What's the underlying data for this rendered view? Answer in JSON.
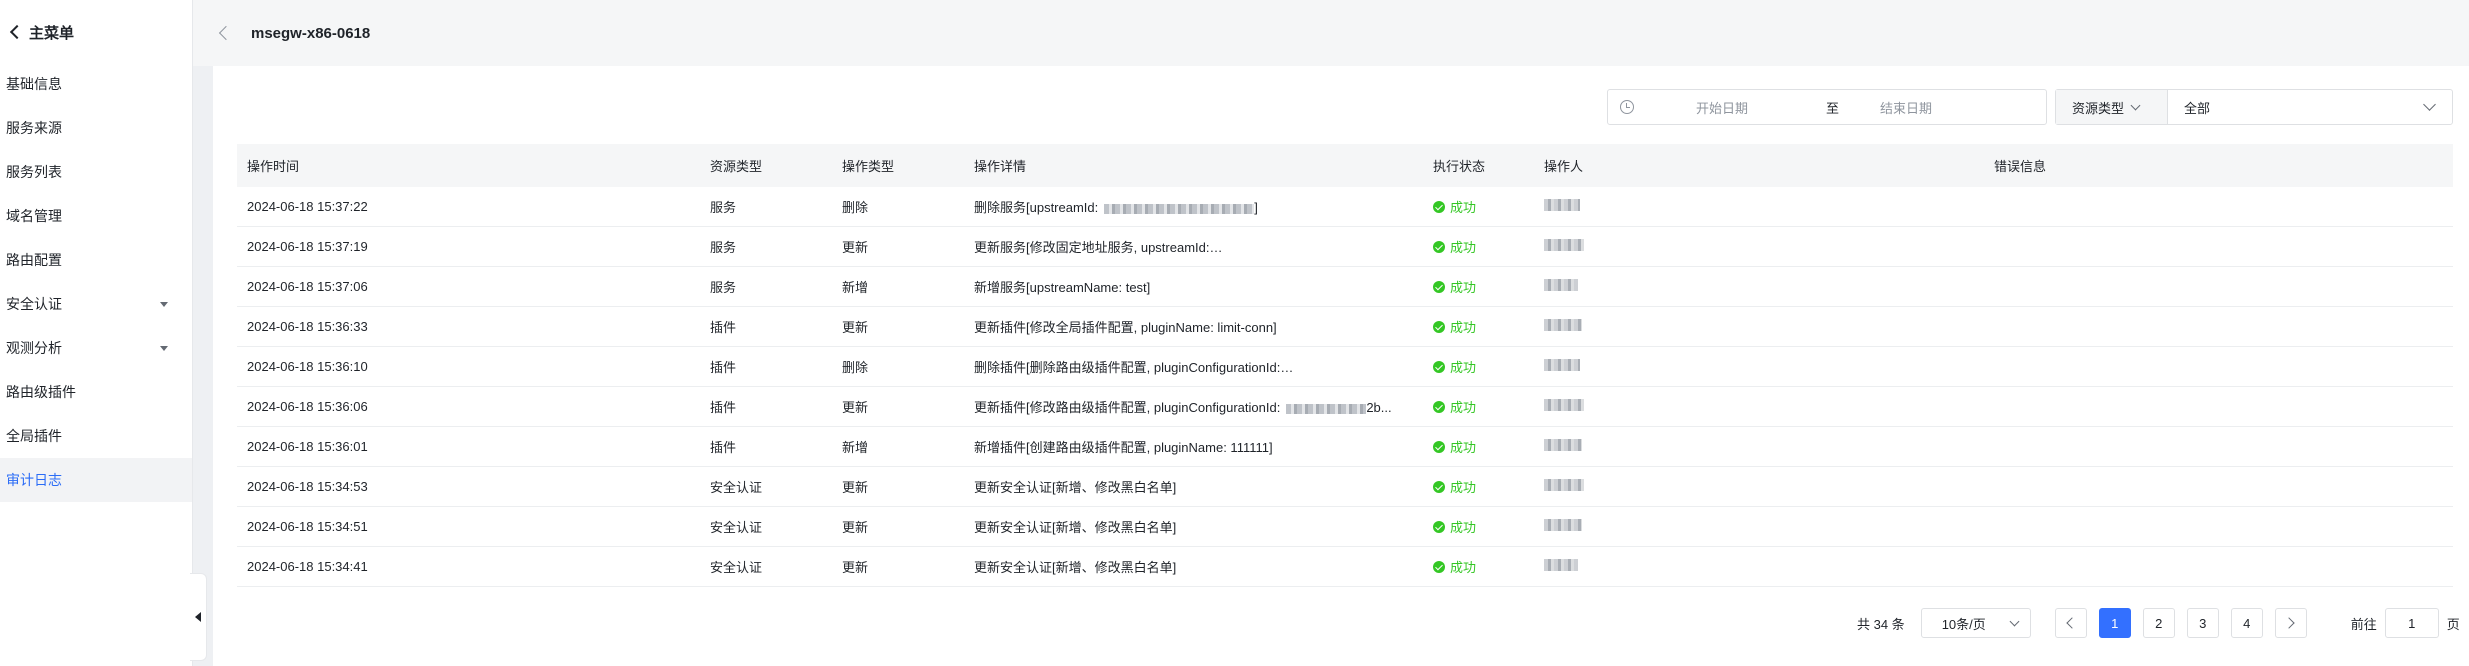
{
  "sidebar": {
    "back_label": "主菜单",
    "items": [
      {
        "label": "基础信息",
        "has_caret": false,
        "active": false
      },
      {
        "label": "服务来源",
        "has_caret": false,
        "active": false
      },
      {
        "label": "服务列表",
        "has_caret": false,
        "active": false
      },
      {
        "label": "域名管理",
        "has_caret": false,
        "active": false
      },
      {
        "label": "路由配置",
        "has_caret": false,
        "active": false
      },
      {
        "label": "安全认证",
        "has_caret": true,
        "active": false
      },
      {
        "label": "观测分析",
        "has_caret": true,
        "active": false
      },
      {
        "label": "路由级插件",
        "has_caret": false,
        "active": false
      },
      {
        "label": "全局插件",
        "has_caret": false,
        "active": false
      },
      {
        "label": "审计日志",
        "has_caret": false,
        "active": true
      }
    ]
  },
  "header": {
    "title": "msegw-x86-0618"
  },
  "filters": {
    "date_start_placeholder": "开始日期",
    "date_separator": "至",
    "date_end_placeholder": "结束日期",
    "resource_type_label": "资源类型",
    "resource_type_value": "全部"
  },
  "table": {
    "columns": [
      "操作时间",
      "资源类型",
      "操作类型",
      "操作详情",
      "执行状态",
      "操作人",
      "错误信息"
    ],
    "rows": [
      {
        "time": "2024-06-18 15:37:22",
        "resource": "服务",
        "op": "删除",
        "detail": "删除服务[upstreamId:",
        "detail_tail": "]",
        "status": "成功"
      },
      {
        "time": "2024-06-18 15:37:19",
        "resource": "服务",
        "op": "更新",
        "detail": "更新服务[修改固定地址服务, upstreamId:",
        "detail_tail": "...",
        "status": "成功"
      },
      {
        "time": "2024-06-18 15:37:06",
        "resource": "服务",
        "op": "新增",
        "detail": "新增服务[upstreamName: test]",
        "detail_tail": "",
        "status": "成功"
      },
      {
        "time": "2024-06-18 15:36:33",
        "resource": "插件",
        "op": "更新",
        "detail": "更新插件[修改全局插件配置, pluginName: limit-conn]",
        "detail_tail": "",
        "status": "成功"
      },
      {
        "time": "2024-06-18 15:36:10",
        "resource": "插件",
        "op": "删除",
        "detail": "删除插件[删除路由级插件配置, pluginConfigurationId:",
        "detail_tail": "...",
        "status": "成功"
      },
      {
        "time": "2024-06-18 15:36:06",
        "resource": "插件",
        "op": "更新",
        "detail": "更新插件[修改路由级插件配置, pluginConfigurationId:",
        "detail_tail": "2b...",
        "status": "成功"
      },
      {
        "time": "2024-06-18 15:36:01",
        "resource": "插件",
        "op": "新增",
        "detail": "新增插件[创建路由级插件配置, pluginName: 111111]",
        "detail_tail": "",
        "status": "成功"
      },
      {
        "time": "2024-06-18 15:34:53",
        "resource": "安全认证",
        "op": "更新",
        "detail": "更新安全认证[新增、修改黑白名单]",
        "detail_tail": "",
        "status": "成功"
      },
      {
        "time": "2024-06-18 15:34:51",
        "resource": "安全认证",
        "op": "更新",
        "detail": "更新安全认证[新增、修改黑白名单]",
        "detail_tail": "",
        "status": "成功"
      },
      {
        "time": "2024-06-18 15:34:41",
        "resource": "安全认证",
        "op": "更新",
        "detail": "更新安全认证[新增、修改黑白名单]",
        "detail_tail": "",
        "status": "成功"
      }
    ]
  },
  "pagination": {
    "total_label": "共 34 条",
    "page_size_label": "10条/页",
    "pages": [
      "1",
      "2",
      "3",
      "4"
    ],
    "current_page": "1",
    "goto_label": "前往",
    "goto_value": "1",
    "goto_suffix": "页"
  },
  "colors": {
    "accent": "#3370ff",
    "active_menu": "#2b6cf6",
    "success": "#34c724"
  }
}
